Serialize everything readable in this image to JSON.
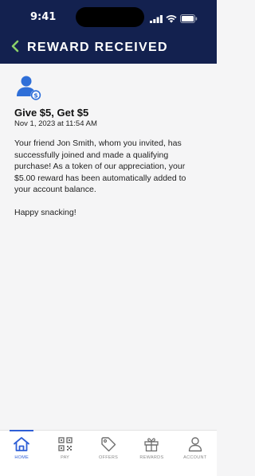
{
  "status_bar": {
    "time": "9:41"
  },
  "header": {
    "title": "REWARD RECEIVED",
    "back_icon": "chevron-left-icon",
    "background": "#13214f",
    "back_color": "#8bd06a"
  },
  "notification": {
    "icon": "user-reward-icon",
    "icon_color": "#2f6fd8",
    "title": "Give $5, Get $5",
    "timestamp": "Nov 1, 2023 at 11:54 AM",
    "message": "Your friend Jon Smith, whom you invited, has successfully joined and made a qualifying purchase! As a token of our appreciation, your $5.00 reward has been automatically added to your account balance.",
    "closing": "Happy snacking!"
  },
  "tabbar": {
    "active_color": "#2f5fd6",
    "tabs": [
      {
        "label": "HOME",
        "icon": "home-icon",
        "active": true
      },
      {
        "label": "PAY",
        "icon": "qr-code-icon",
        "active": false
      },
      {
        "label": "OFFERS",
        "icon": "tag-icon",
        "active": false
      },
      {
        "label": "REWARDS",
        "icon": "gift-icon",
        "active": false
      },
      {
        "label": "ACCOUNT",
        "icon": "person-icon",
        "active": false
      }
    ]
  }
}
